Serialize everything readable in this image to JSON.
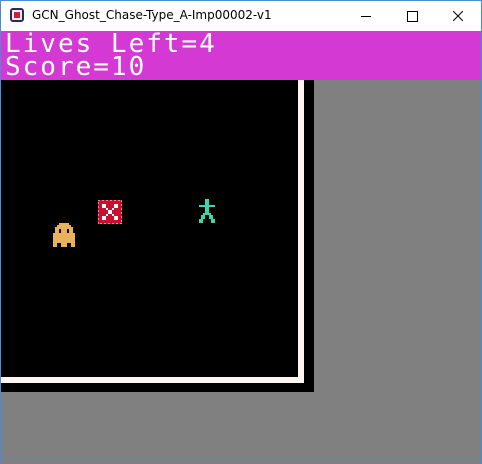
{
  "window": {
    "title": "GCN_Ghost_Chase-Type_A-Imp00002-v1",
    "icon": "app-icon",
    "controls": [
      "minimize-icon",
      "maximize-icon",
      "close-icon"
    ]
  },
  "hud": {
    "lives_text": "Lives Left=4",
    "score_text": "Score=10",
    "background_color": "#d439d4",
    "text_color": "#ffffff"
  },
  "game": {
    "playfield_color": "#000000",
    "wall_color": "#fff5f0",
    "outside_color": "#808080",
    "sprites": [
      {
        "name": "ghost",
        "color": "#e8b25a"
      },
      {
        "name": "goal-box",
        "color": "#c8102e"
      },
      {
        "name": "player",
        "color": "#3fd4b0"
      }
    ]
  }
}
